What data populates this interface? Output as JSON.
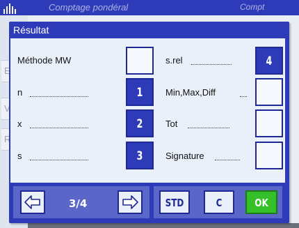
{
  "background": {
    "title": "Comptage pondéral",
    "title_right": "Compt",
    "side_items": [
      "Er",
      "Va",
      "Ré"
    ]
  },
  "dialog": {
    "title": "Résultat",
    "left_rows": [
      {
        "label": "Méthode MW",
        "number": ""
      },
      {
        "label": "n",
        "number": "1"
      },
      {
        "label": "x",
        "number": "2"
      },
      {
        "label": "s",
        "number": "3"
      }
    ],
    "right_rows": [
      {
        "label": "s.rel",
        "number": "4"
      },
      {
        "label": "Min,Max,Diff",
        "number": ""
      },
      {
        "label": "Tot",
        "number": ""
      },
      {
        "label": "Signature",
        "number": ""
      }
    ]
  },
  "toolbar": {
    "page_indicator": "3/4",
    "prev_icon": "arrow-left-icon",
    "next_icon": "arrow-right-icon",
    "std_label": "STD",
    "c_label": "C",
    "ok_label": "OK"
  },
  "colors": {
    "title_bar": "#2e3bb8",
    "content_bg": "#eaf0fa",
    "active_box": "#2e3bb8",
    "ok_button": "#35c02a"
  }
}
